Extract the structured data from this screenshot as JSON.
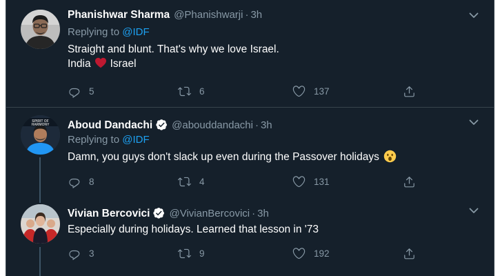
{
  "theme": {
    "background": "#15202b",
    "border": "#38444d",
    "text": "#ffffff",
    "muted": "#8899a6",
    "link": "#1da1f2",
    "heart": "#e0245e"
  },
  "tweets": [
    {
      "name": "Phanishwar Sharma",
      "verified": false,
      "handle": "@Phanishwarji",
      "dot": "·",
      "time": "3h",
      "replying_prefix": "Replying to",
      "replying_to": "@IDF",
      "text_line1": "Straight and blunt. That's why we love Israel.",
      "text_line2_before": "India",
      "text_line2_emoji": "red-heart-emoji",
      "text_line2_after": "Israel",
      "replies": "5",
      "retweets": "6",
      "likes": "137"
    },
    {
      "name": "Aboud Dandachi",
      "verified": true,
      "handle": "@abouddandachi",
      "dot": "·",
      "time": "3h",
      "replying_prefix": "Replying to",
      "replying_to": "@IDF",
      "text": "Damn, you guys don't slack up even during the Passover holidays",
      "text_emoji": "astonished-face-emoji",
      "replies": "8",
      "retweets": "4",
      "likes": "131"
    },
    {
      "name": "Vivian Bercovici",
      "verified": true,
      "handle": "@VivianBercovici",
      "dot": "·",
      "time": "3h",
      "text": "Especially during holidays. Learned that lesson in '73",
      "replies": "3",
      "retweets": "9",
      "likes": "192"
    }
  ],
  "icons": {
    "reply": "reply-icon",
    "retweet": "retweet-icon",
    "like": "like-icon",
    "share": "share-icon",
    "caret": "chevron-down-icon",
    "verified": "verified-badge-icon"
  }
}
